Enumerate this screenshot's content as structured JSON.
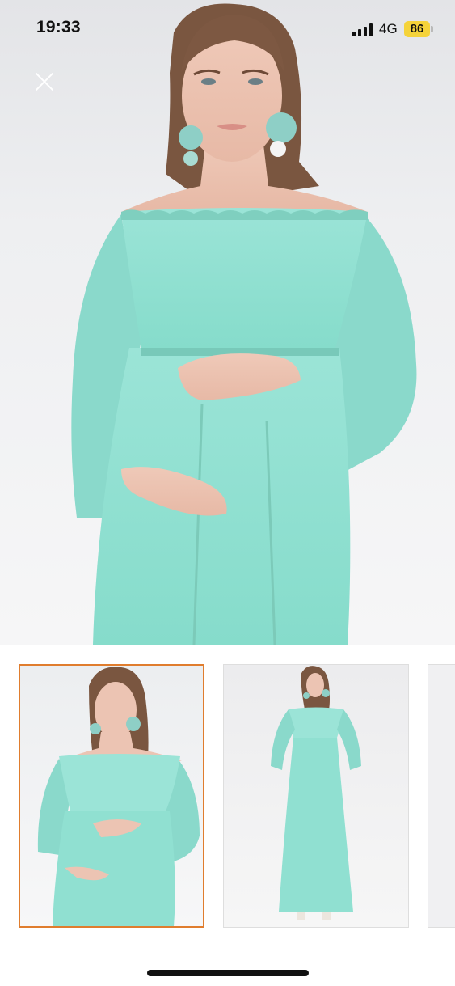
{
  "status_bar": {
    "time": "19:33",
    "network": "4G",
    "battery": "86",
    "battery_color": "#f5d33a"
  },
  "viewer": {
    "close_icon": "close-icon",
    "selected_thumbnail": 1,
    "selected_border_color": "#e07d2e",
    "dress_color": "#8fe0d2"
  }
}
